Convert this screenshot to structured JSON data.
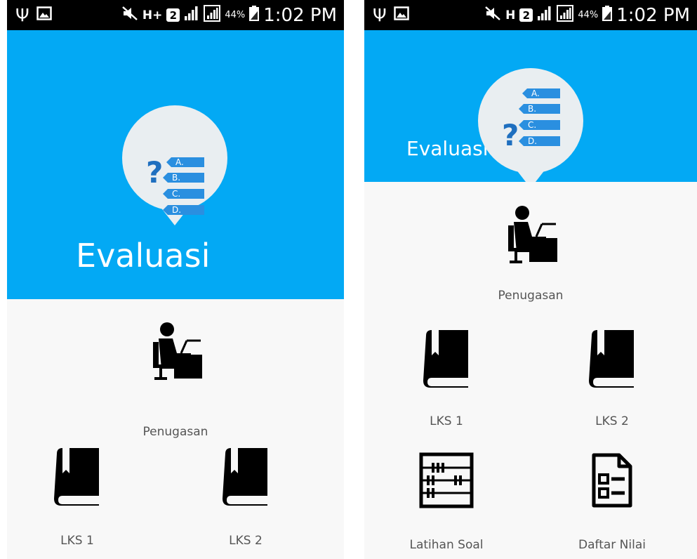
{
  "screens": [
    {
      "status_bar": {
        "time": "1:02 PM",
        "battery_percent": "44%",
        "network_type": "H+",
        "sim_slot": "2"
      },
      "header": {
        "title": "Evaluasi",
        "background_color": "#03a9f4",
        "badge_icon": "quiz-options-icon",
        "option_letters": [
          "A.",
          "B.",
          "C.",
          "D."
        ]
      },
      "menu": [
        {
          "label": "Penugasan",
          "icon": "person-at-desk-icon"
        },
        {
          "label": "LKS 1",
          "icon": "book-icon"
        },
        {
          "label": "LKS 2",
          "icon": "book-icon"
        }
      ]
    },
    {
      "status_bar": {
        "time": "1:02 PM",
        "battery_percent": "44%",
        "network_type": "H",
        "sim_slot": "2"
      },
      "header": {
        "title": "Evaluasi",
        "background_color": "#03a9f4",
        "badge_icon": "quiz-options-icon",
        "option_letters": [
          "A.",
          "B.",
          "C.",
          "D."
        ]
      },
      "menu": [
        {
          "label": "Penugasan",
          "icon": "person-at-desk-icon"
        },
        {
          "label": "LKS 1",
          "icon": "book-icon"
        },
        {
          "label": "LKS 2",
          "icon": "book-icon"
        },
        {
          "label": "Latihan Soal",
          "icon": "abacus-icon"
        },
        {
          "label": "Daftar Nilai",
          "icon": "document-list-icon"
        }
      ]
    }
  ]
}
